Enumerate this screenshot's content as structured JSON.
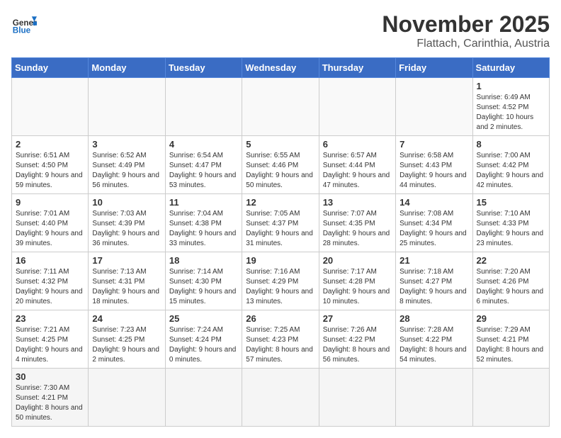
{
  "header": {
    "logo_general": "General",
    "logo_blue": "Blue",
    "title": "November 2025",
    "subtitle": "Flattach, Carinthia, Austria"
  },
  "weekdays": [
    "Sunday",
    "Monday",
    "Tuesday",
    "Wednesday",
    "Thursday",
    "Friday",
    "Saturday"
  ],
  "weeks": [
    [
      {
        "day": "",
        "info": ""
      },
      {
        "day": "",
        "info": ""
      },
      {
        "day": "",
        "info": ""
      },
      {
        "day": "",
        "info": ""
      },
      {
        "day": "",
        "info": ""
      },
      {
        "day": "",
        "info": ""
      },
      {
        "day": "1",
        "info": "Sunrise: 6:49 AM\nSunset: 4:52 PM\nDaylight: 10 hours and 2 minutes."
      }
    ],
    [
      {
        "day": "2",
        "info": "Sunrise: 6:51 AM\nSunset: 4:50 PM\nDaylight: 9 hours and 59 minutes."
      },
      {
        "day": "3",
        "info": "Sunrise: 6:52 AM\nSunset: 4:49 PM\nDaylight: 9 hours and 56 minutes."
      },
      {
        "day": "4",
        "info": "Sunrise: 6:54 AM\nSunset: 4:47 PM\nDaylight: 9 hours and 53 minutes."
      },
      {
        "day": "5",
        "info": "Sunrise: 6:55 AM\nSunset: 4:46 PM\nDaylight: 9 hours and 50 minutes."
      },
      {
        "day": "6",
        "info": "Sunrise: 6:57 AM\nSunset: 4:44 PM\nDaylight: 9 hours and 47 minutes."
      },
      {
        "day": "7",
        "info": "Sunrise: 6:58 AM\nSunset: 4:43 PM\nDaylight: 9 hours and 44 minutes."
      },
      {
        "day": "8",
        "info": "Sunrise: 7:00 AM\nSunset: 4:42 PM\nDaylight: 9 hours and 42 minutes."
      }
    ],
    [
      {
        "day": "9",
        "info": "Sunrise: 7:01 AM\nSunset: 4:40 PM\nDaylight: 9 hours and 39 minutes."
      },
      {
        "day": "10",
        "info": "Sunrise: 7:03 AM\nSunset: 4:39 PM\nDaylight: 9 hours and 36 minutes."
      },
      {
        "day": "11",
        "info": "Sunrise: 7:04 AM\nSunset: 4:38 PM\nDaylight: 9 hours and 33 minutes."
      },
      {
        "day": "12",
        "info": "Sunrise: 7:05 AM\nSunset: 4:37 PM\nDaylight: 9 hours and 31 minutes."
      },
      {
        "day": "13",
        "info": "Sunrise: 7:07 AM\nSunset: 4:35 PM\nDaylight: 9 hours and 28 minutes."
      },
      {
        "day": "14",
        "info": "Sunrise: 7:08 AM\nSunset: 4:34 PM\nDaylight: 9 hours and 25 minutes."
      },
      {
        "day": "15",
        "info": "Sunrise: 7:10 AM\nSunset: 4:33 PM\nDaylight: 9 hours and 23 minutes."
      }
    ],
    [
      {
        "day": "16",
        "info": "Sunrise: 7:11 AM\nSunset: 4:32 PM\nDaylight: 9 hours and 20 minutes."
      },
      {
        "day": "17",
        "info": "Sunrise: 7:13 AM\nSunset: 4:31 PM\nDaylight: 9 hours and 18 minutes."
      },
      {
        "day": "18",
        "info": "Sunrise: 7:14 AM\nSunset: 4:30 PM\nDaylight: 9 hours and 15 minutes."
      },
      {
        "day": "19",
        "info": "Sunrise: 7:16 AM\nSunset: 4:29 PM\nDaylight: 9 hours and 13 minutes."
      },
      {
        "day": "20",
        "info": "Sunrise: 7:17 AM\nSunset: 4:28 PM\nDaylight: 9 hours and 10 minutes."
      },
      {
        "day": "21",
        "info": "Sunrise: 7:18 AM\nSunset: 4:27 PM\nDaylight: 9 hours and 8 minutes."
      },
      {
        "day": "22",
        "info": "Sunrise: 7:20 AM\nSunset: 4:26 PM\nDaylight: 9 hours and 6 minutes."
      }
    ],
    [
      {
        "day": "23",
        "info": "Sunrise: 7:21 AM\nSunset: 4:25 PM\nDaylight: 9 hours and 4 minutes."
      },
      {
        "day": "24",
        "info": "Sunrise: 7:23 AM\nSunset: 4:25 PM\nDaylight: 9 hours and 2 minutes."
      },
      {
        "day": "25",
        "info": "Sunrise: 7:24 AM\nSunset: 4:24 PM\nDaylight: 9 hours and 0 minutes."
      },
      {
        "day": "26",
        "info": "Sunrise: 7:25 AM\nSunset: 4:23 PM\nDaylight: 8 hours and 57 minutes."
      },
      {
        "day": "27",
        "info": "Sunrise: 7:26 AM\nSunset: 4:22 PM\nDaylight: 8 hours and 56 minutes."
      },
      {
        "day": "28",
        "info": "Sunrise: 7:28 AM\nSunset: 4:22 PM\nDaylight: 8 hours and 54 minutes."
      },
      {
        "day": "29",
        "info": "Sunrise: 7:29 AM\nSunset: 4:21 PM\nDaylight: 8 hours and 52 minutes."
      }
    ],
    [
      {
        "day": "30",
        "info": "Sunrise: 7:30 AM\nSunset: 4:21 PM\nDaylight: 8 hours and 50 minutes."
      },
      {
        "day": "",
        "info": ""
      },
      {
        "day": "",
        "info": ""
      },
      {
        "day": "",
        "info": ""
      },
      {
        "day": "",
        "info": ""
      },
      {
        "day": "",
        "info": ""
      },
      {
        "day": "",
        "info": ""
      }
    ]
  ]
}
